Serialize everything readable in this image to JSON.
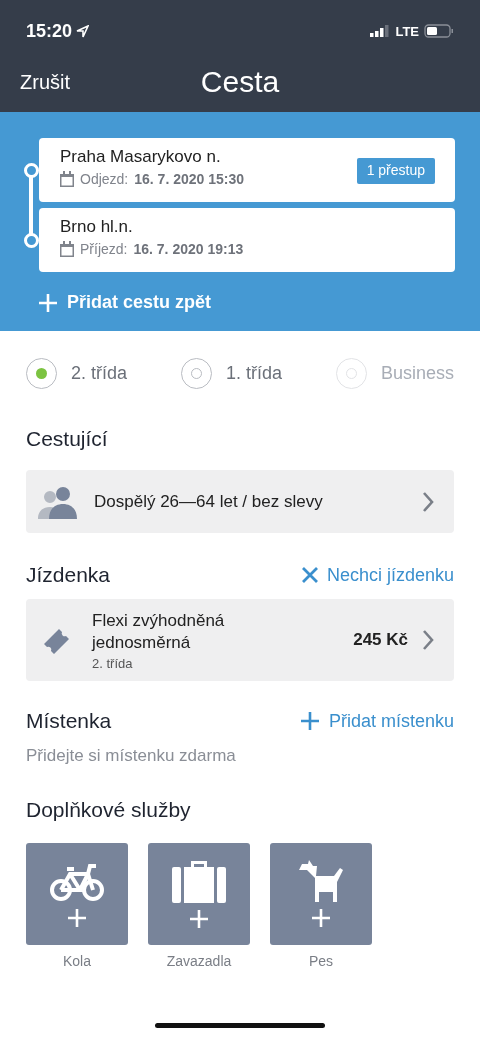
{
  "status_bar": {
    "time": "15:20",
    "network": "LTE"
  },
  "nav": {
    "cancel": "Zrušit",
    "title": "Cesta"
  },
  "journey": {
    "stops": [
      {
        "station": "Praha Masarykovo n.",
        "time_label": "Odjezd:",
        "datetime": "16. 7. 2020 15:30",
        "badge": "1 přestup"
      },
      {
        "station": "Brno hl.n.",
        "time_label": "Příjezd:",
        "datetime": "16. 7. 2020 19:13"
      }
    ],
    "add_return": "Přidat cestu zpět"
  },
  "classes": [
    {
      "label": "2. třída",
      "selected": true,
      "disabled": false
    },
    {
      "label": "1. třída",
      "selected": false,
      "disabled": false
    },
    {
      "label": "Business",
      "selected": false,
      "disabled": true
    }
  ],
  "passengers": {
    "title": "Cestující",
    "item": "Dospělý 26—64 let / bez slevy"
  },
  "ticket": {
    "title": "Jízdenka",
    "action": "Nechci jízdenku",
    "name": "Flexi zvýhodněná jednosměrná",
    "class": "2. třída",
    "price": "245 Kč"
  },
  "seat": {
    "title": "Místenka",
    "action": "Přidat místenku",
    "hint": "Přidejte si místenku zdarma"
  },
  "services": {
    "title": "Doplňkové služby",
    "items": [
      {
        "kind": "bike",
        "label": "Kola"
      },
      {
        "kind": "luggage",
        "label": "Zavazadla"
      },
      {
        "kind": "dog",
        "label": "Pes"
      }
    ]
  }
}
